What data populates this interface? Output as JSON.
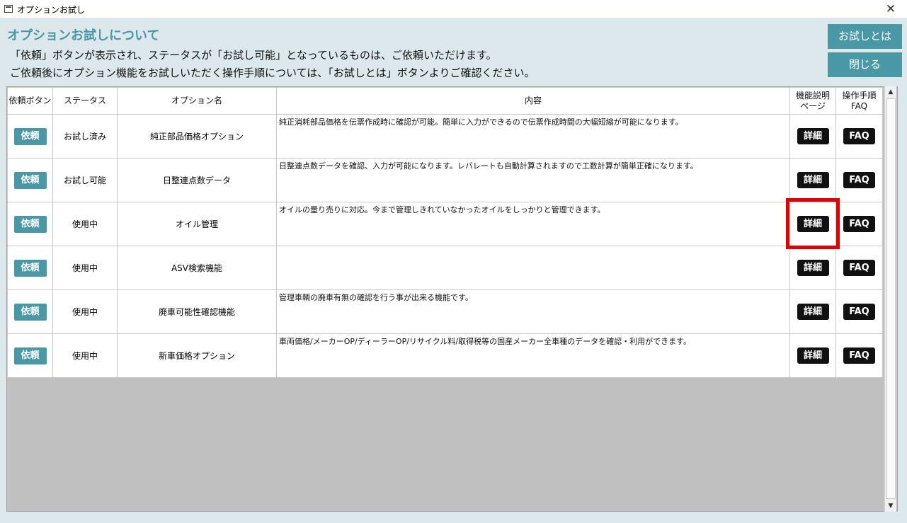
{
  "window": {
    "title": "オプションお試し",
    "close_glyph": "✕"
  },
  "header": {
    "heading": "オプションお試しについて",
    "line1": "「依頼」ボタンが表示され、ステータスが「お試し可能」となっているものは、ご依頼いただけます。",
    "line2": "ご依頼後にオプション機能をお試しいただく操作手順については、「お試しとは」ボタンよりご確認ください。"
  },
  "buttons": {
    "about": "お試しとは",
    "close": "閉じる"
  },
  "table": {
    "headers": {
      "request": "依頼ボタン",
      "status": "ステータス",
      "option": "オプション名",
      "content": "内容",
      "detail_line1": "機能説明",
      "detail_line2": "ページ",
      "faq_line1": "操作手順",
      "faq_line2": "FAQ"
    },
    "rows": [
      {
        "request_label": "依頼",
        "status": "お試し済み",
        "option": "純正部品価格オプション",
        "content": "純正消耗部品価格を伝票作成時に確認が可能。簡単に入力ができるので伝票作成時間の大幅短縮が可能になります。",
        "detail_label": "詳細",
        "faq_label": "FAQ"
      },
      {
        "request_label": "依頼",
        "status": "お試し可能",
        "option": "日整連点数データ",
        "content": "日整連点数データを確認、入力が可能になります。レバレートも自動計算されますので工数計算が簡単正確になります。",
        "detail_label": "詳細",
        "faq_label": "FAQ"
      },
      {
        "request_label": "依頼",
        "status": "使用中",
        "option": "オイル管理",
        "content": "オイルの量り売りに対応。今まで管理しきれていなかったオイルをしっかりと管理できます。",
        "detail_label": "詳細",
        "faq_label": "FAQ"
      },
      {
        "request_label": "依頼",
        "status": "使用中",
        "option": "ASV検索機能",
        "content": "",
        "detail_label": "詳細",
        "faq_label": "FAQ"
      },
      {
        "request_label": "依頼",
        "status": "使用中",
        "option": "廃車可能性確認機能",
        "content": "管理車輌の廃車有無の確認を行う事が出来る機能です。",
        "detail_label": "詳細",
        "faq_label": "FAQ"
      },
      {
        "request_label": "依頼",
        "status": "使用中",
        "option": "新車価格オプション",
        "content": "車両価格/メーカーOP/ディーラーOP/リサイクル料/取得税等の国産メーカー全車種のデータを確認・利用ができます。",
        "detail_label": "詳細",
        "faq_label": "FAQ"
      }
    ]
  },
  "scrollbar": {
    "up_glyph": "▲",
    "down_glyph": "▼"
  },
  "colors": {
    "accent": "#4a98a6",
    "highlight": "#e00000",
    "dark_button": "#111111",
    "background": "#dce8ec"
  }
}
